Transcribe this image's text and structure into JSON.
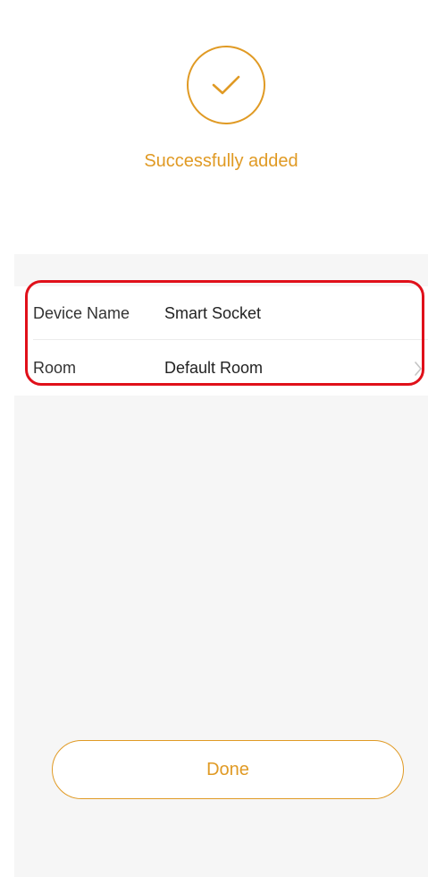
{
  "colors": {
    "accent": "#e09a24",
    "highlight": "#e0101a",
    "background": "#f6f6f6"
  },
  "success": {
    "icon": "checkmark-icon",
    "message": "Successfully added"
  },
  "device_info": {
    "rows": [
      {
        "label": "Device Name",
        "value": "Smart Socket"
      },
      {
        "label": "Room",
        "value": "Default Room",
        "trailing_icon": "chevron-right-icon"
      }
    ]
  },
  "actions": {
    "done_label": "Done"
  }
}
